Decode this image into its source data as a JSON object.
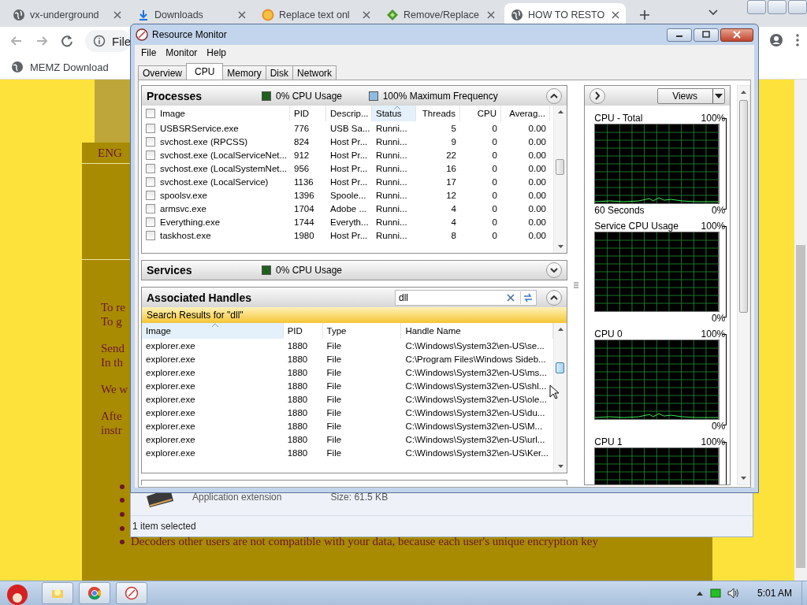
{
  "browser": {
    "tabs": [
      {
        "title": "vx-underground",
        "selected": false
      },
      {
        "title": "Downloads",
        "selected": false
      },
      {
        "title": "Replace text onl",
        "selected": false
      },
      {
        "title": "Remove/Replace",
        "selected": false
      },
      {
        "title": "HOW TO RESTO",
        "selected": true
      }
    ],
    "address": "File",
    "bookmarks": [
      "MEMZ Download"
    ]
  },
  "page": {
    "heading": "ENG",
    "paragraphs": [
      [
        "To re",
        "To g"
      ],
      [
        "Send",
        "In th"
      ],
      [
        "We w"
      ],
      [
        "Afte",
        "instr"
      ]
    ],
    "bullets": [
      {
        "kind": "covered"
      },
      {
        "kind": "covered"
      },
      {
        "kind": "covered"
      },
      {
        "kind": "covered"
      },
      {
        "kind": "text",
        "text": "Decoders other users are not compatible with your data, because each user's unique encryption key"
      }
    ]
  },
  "explorer": {
    "file_type": "Application extension",
    "size": "Size: 61.5 KB",
    "status": "1 item selected"
  },
  "resmon": {
    "title": "Resource Monitor",
    "menu": [
      "File",
      "Monitor",
      "Help"
    ],
    "tabs": [
      {
        "label": "Overview",
        "selected": false
      },
      {
        "label": "CPU",
        "selected": true
      },
      {
        "label": "Memory",
        "selected": false
      },
      {
        "label": "Disk",
        "selected": false
      },
      {
        "label": "Network",
        "selected": false
      }
    ],
    "processes": {
      "title": "Processes",
      "expanded": true,
      "legend": [
        {
          "label": "0% CPU Usage",
          "color": "#1f5f1f"
        },
        {
          "label": "100% Maximum Frequency",
          "color": "#8fbbe3"
        }
      ],
      "all_checked": false,
      "columns": [
        {
          "label": "Image",
          "sorted": false,
          "numeric": false
        },
        {
          "label": "PID",
          "sorted": false,
          "numeric": false
        },
        {
          "label": "Descrip...",
          "sorted": false,
          "numeric": false
        },
        {
          "label": "Status",
          "sorted": true,
          "numeric": false
        },
        {
          "label": "Threads",
          "sorted": false,
          "numeric": true
        },
        {
          "label": "CPU",
          "sorted": false,
          "numeric": true
        },
        {
          "label": "Averag...",
          "sorted": false,
          "numeric": true
        }
      ],
      "rows": [
        {
          "checked": false,
          "cells": [
            "USBSRService.exe",
            "776",
            "USB Sa...",
            "Runni...",
            "5",
            "0",
            "0.00"
          ]
        },
        {
          "checked": false,
          "cells": [
            "svchost.exe (RPCSS)",
            "824",
            "Host Pr...",
            "Runni...",
            "9",
            "0",
            "0.00"
          ]
        },
        {
          "checked": false,
          "cells": [
            "svchost.exe (LocalServiceNet...",
            "912",
            "Host Pr...",
            "Runni...",
            "22",
            "0",
            "0.00"
          ]
        },
        {
          "checked": false,
          "cells": [
            "svchost.exe (LocalSystemNet...",
            "956",
            "Host Pr...",
            "Runni...",
            "16",
            "0",
            "0.00"
          ]
        },
        {
          "checked": false,
          "cells": [
            "svchost.exe (LocalService)",
            "1136",
            "Host Pr...",
            "Runni...",
            "17",
            "0",
            "0.00"
          ]
        },
        {
          "checked": false,
          "cells": [
            "spoolsv.exe",
            "1396",
            "Spoole...",
            "Runni...",
            "12",
            "0",
            "0.00"
          ]
        },
        {
          "checked": false,
          "cells": [
            "armsvc.exe",
            "1704",
            "Adobe ...",
            "Runni...",
            "4",
            "0",
            "0.00"
          ]
        },
        {
          "checked": false,
          "cells": [
            "Everything.exe",
            "1744",
            "Everyth...",
            "Runni...",
            "4",
            "0",
            "0.00"
          ]
        },
        {
          "checked": false,
          "cells": [
            "taskhost.exe",
            "1980",
            "Host Pr...",
            "Runni...",
            "8",
            "0",
            "0.00"
          ]
        }
      ]
    },
    "services": {
      "title": "Services",
      "expanded": false,
      "legend": [
        {
          "label": "0% CPU Usage",
          "color": "#1f5f1f"
        }
      ]
    },
    "handles": {
      "title": "Associated Handles",
      "expanded": true,
      "search": "dll",
      "banner": "Search Results for \"dll\"",
      "columns": [
        {
          "label": "Image",
          "sorted": true
        },
        {
          "label": "PID",
          "sorted": false
        },
        {
          "label": "Type",
          "sorted": false
        },
        {
          "label": "Handle Name",
          "sorted": false
        }
      ],
      "rows": [
        [
          "explorer.exe",
          "1880",
          "File",
          "C:\\Windows\\System32\\en-US\\se..."
        ],
        [
          "explorer.exe",
          "1880",
          "File",
          "C:\\Program Files\\Windows Sideb..."
        ],
        [
          "explorer.exe",
          "1880",
          "File",
          "C:\\Windows\\System32\\en-US\\ms..."
        ],
        [
          "explorer.exe",
          "1880",
          "File",
          "C:\\Windows\\System32\\en-US\\shl..."
        ],
        [
          "explorer.exe",
          "1880",
          "File",
          "C:\\Windows\\System32\\en-US\\ole..."
        ],
        [
          "explorer.exe",
          "1880",
          "File",
          "C:\\Windows\\System32\\en-US\\du..."
        ],
        [
          "explorer.exe",
          "1880",
          "File",
          "C:\\Windows\\System32\\en-US\\M..."
        ],
        [
          "explorer.exe",
          "1880",
          "File",
          "C:\\Windows\\System32\\en-US\\url..."
        ],
        [
          "explorer.exe",
          "1880",
          "File",
          "C:\\Windows\\System32\\en-US\\Ker..."
        ]
      ]
    },
    "views_button": "Views",
    "graphs": [
      {
        "title": "CPU - Total",
        "max": "100%",
        "footer": "60 Seconds",
        "min": "0%",
        "activity": true
      },
      {
        "title": "Service CPU Usage",
        "max": "100%",
        "min": "0%",
        "activity": false
      },
      {
        "title": "CPU 0",
        "max": "100%",
        "min": "0%",
        "activity": true
      },
      {
        "title": "CPU 1",
        "max": "100%",
        "activity": false
      }
    ]
  },
  "taskbar": {
    "clock": "5:01 AM"
  }
}
